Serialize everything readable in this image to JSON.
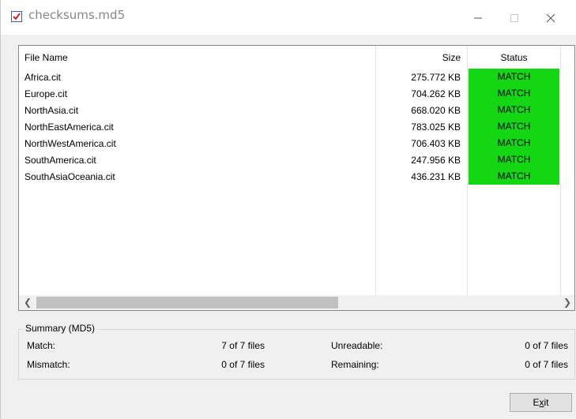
{
  "window": {
    "title": "checksums.md5",
    "icon": "md5-checklist-icon"
  },
  "list": {
    "columns": {
      "file_name": "File Name",
      "size": "Size",
      "status": "Status"
    },
    "rows": [
      {
        "file": "Africa.cit",
        "size": "275.772 KB",
        "status": "MATCH"
      },
      {
        "file": "Europe.cit",
        "size": "704.262 KB",
        "status": "MATCH"
      },
      {
        "file": "NorthAsia.cit",
        "size": "668.020 KB",
        "status": "MATCH"
      },
      {
        "file": "NorthEastAmerica.cit",
        "size": "783.025 KB",
        "status": "MATCH"
      },
      {
        "file": "NorthWestAmerica.cit",
        "size": "706.403 KB",
        "status": "MATCH"
      },
      {
        "file": "SouthAmerica.cit",
        "size": "247.956 KB",
        "status": "MATCH"
      },
      {
        "file": "SouthAsiaOceania.cit",
        "size": "436.231 KB",
        "status": "MATCH"
      }
    ],
    "match_color": "#12d712"
  },
  "summary": {
    "title": "Summary (MD5)",
    "match_label": "Match:",
    "match_value": "7 of 7 files",
    "mismatch_label": "Mismatch:",
    "mismatch_value": "0 of 7 files",
    "unreadable_label": "Unreadable:",
    "unreadable_value": "0 of 7 files",
    "remaining_label": "Remaining:",
    "remaining_value": "0 of 7 files"
  },
  "buttons": {
    "exit_label_pre": "E",
    "exit_label_u": "x",
    "exit_label_post": "it"
  }
}
